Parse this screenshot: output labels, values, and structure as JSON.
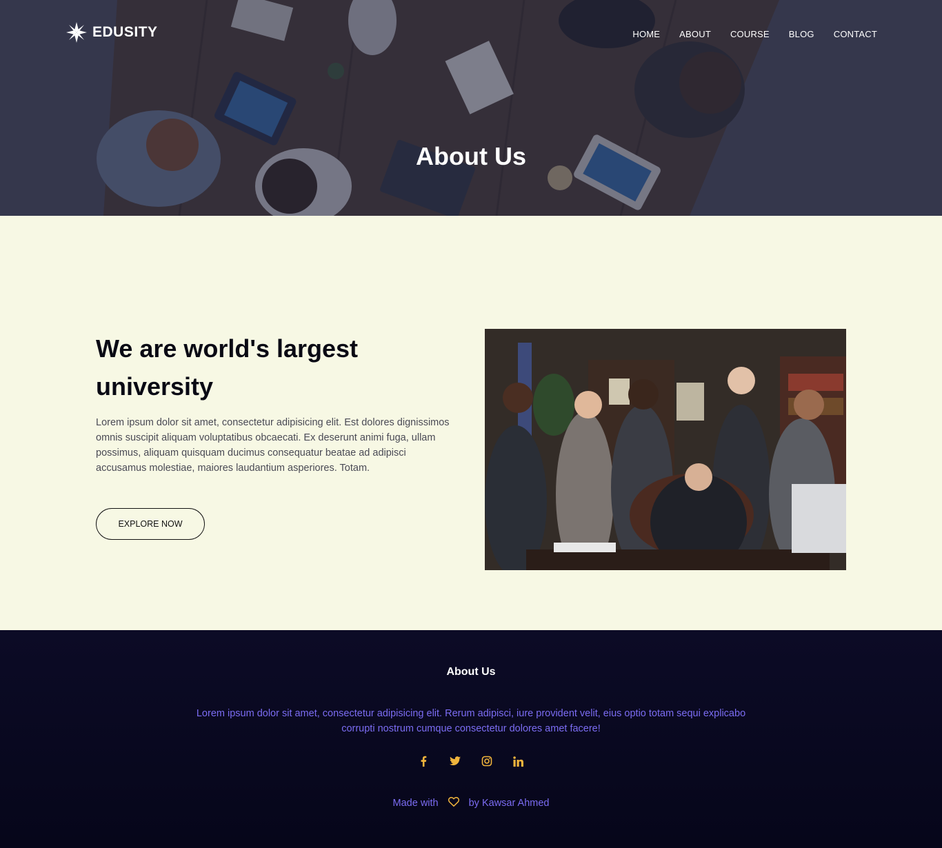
{
  "header": {
    "logo_text": "EDUSITY",
    "nav": [
      {
        "label": "HOME"
      },
      {
        "label": "ABOUT"
      },
      {
        "label": "COURSE"
      },
      {
        "label": "BLOG"
      },
      {
        "label": "CONTACT"
      }
    ],
    "hero_title": "About Us"
  },
  "about": {
    "heading": "We are world's largest university",
    "body": "Lorem ipsum dolor sit amet, consectetur adipisicing elit. Est dolores dignissimos omnis suscipit aliquam voluptatibus obcaecati. Ex deserunt animi fuga, ullam possimus, aliquam quisquam ducimus consequatur beatae ad adipisci accusamus molestiae, maiores laudantium asperiores. Totam.",
    "button_label": "EXPLORE NOW"
  },
  "footer": {
    "title": "About Us",
    "text": "Lorem ipsum dolor sit amet, consectetur adipisicing elit. Rerum adipisci, iure provident velit, eius optio totam sequi explicabo corrupti nostrum cumque consectetur dolores amet facere!",
    "socials": [
      {
        "icon": "facebook-icon"
      },
      {
        "icon": "twitter-icon"
      },
      {
        "icon": "instagram-icon"
      },
      {
        "icon": "linkedin-icon"
      }
    ],
    "credit_prefix": "Made with",
    "credit_icon": "heart-icon",
    "credit_suffix": "by Kawsar Ahmed"
  },
  "colors": {
    "accent": "#7b6cf2",
    "social_icon": "#f0b43c",
    "footer_bg": "#0c0b26",
    "about_bg": "#f7f8e4"
  }
}
